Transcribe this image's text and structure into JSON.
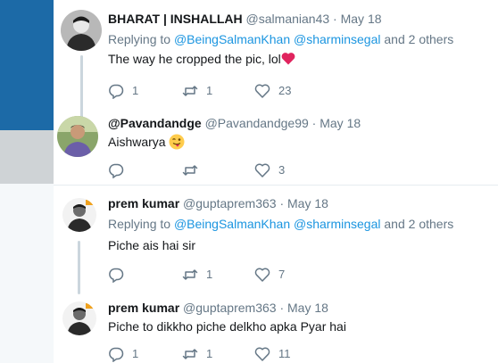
{
  "tweets": [
    {
      "name": "BHARAT | INSHALLAH",
      "handle": "@salmanian43",
      "dot": "·",
      "time": "May 18",
      "replying_prefix": "Replying to",
      "reply_user1": "@BeingSalmanKhan",
      "reply_user2": "@sharminsegal",
      "reply_suffix": "and 2 others",
      "text": "The way he cropped the pic, lol",
      "text_emoji": "heart",
      "replies": "1",
      "retweets": "1",
      "likes": "23"
    },
    {
      "name": "@Pavandandge",
      "handle": "@Pavandandge99",
      "dot": "·",
      "time": "May 18",
      "text": "Aishwarya",
      "text_emoji": "winking-face-with-tongue",
      "replies": "",
      "retweets": "",
      "likes": "3"
    },
    {
      "name": "prem kumar",
      "handle": "@guptaprem363",
      "dot": "·",
      "time": "May 18",
      "replying_prefix": "Replying to",
      "reply_user1": "@BeingSalmanKhan",
      "reply_user2": "@sharminsegal",
      "reply_suffix": "and 2 others",
      "text": "Piche ais hai sir",
      "replies": "",
      "retweets": "1",
      "likes": "7"
    },
    {
      "name": "prem kumar",
      "handle": "@guptaprem363",
      "dot": "·",
      "time": "May 18",
      "text": "Piche to dikkho piche delkho apka Pyar hai",
      "replies": "1",
      "retweets": "1",
      "likes": "11"
    }
  ],
  "colors": {
    "link": "#1b95e0",
    "muted": "#657786",
    "heart": "#e0245e",
    "sidebar_blue": "#1c6aa7"
  },
  "icons": [
    "reply-icon",
    "retweet-icon",
    "like-icon"
  ]
}
